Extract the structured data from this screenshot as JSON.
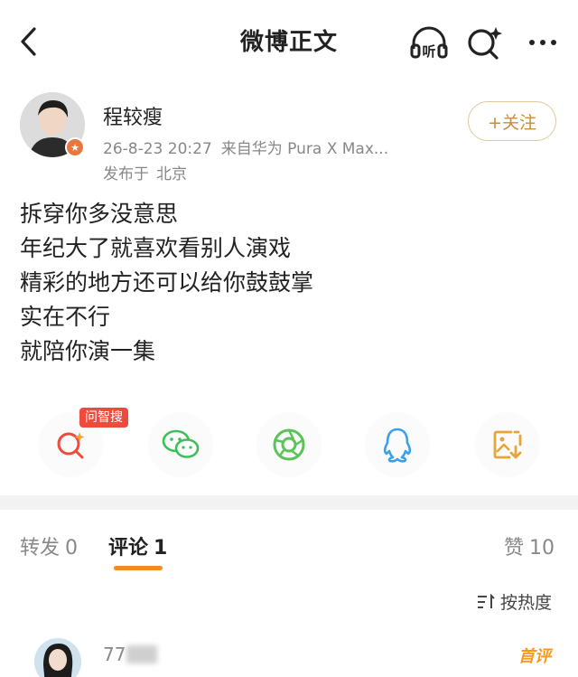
{
  "nav": {
    "title": "微博正文",
    "listen_label": "听"
  },
  "author": {
    "name": "程较瘦",
    "date": "26-8-23 20:27",
    "source": "来自华为 Pura X Max...",
    "location_prefix": "发布于",
    "location": "北京",
    "follow_label": "+关注"
  },
  "post": {
    "lines": [
      "拆穿你多没意思",
      "年纪大了就喜欢看别人演戏",
      "精彩的地方还可以给你鼓鼓掌",
      "实在不行",
      "就陪你演一集"
    ]
  },
  "share": {
    "smart_tag": "问智搜",
    "items": [
      {
        "icon": "smart-search-icon",
        "color": "#f04a3c"
      },
      {
        "icon": "wechat-icon",
        "color": "#3cbf5a"
      },
      {
        "icon": "moments-icon",
        "color": "#5ac35a"
      },
      {
        "icon": "qq-icon",
        "color": "#3aa0e8"
      },
      {
        "icon": "save-image-icon",
        "color": "#e8a53a"
      }
    ]
  },
  "tabs": {
    "repost_label": "转发",
    "repost_count": "0",
    "comment_label": "评论",
    "comment_count": "1",
    "like_label": "赞",
    "like_count": "10"
  },
  "sort": {
    "label": "按热度"
  },
  "comment": {
    "name_visible": "77",
    "tag": "首评"
  },
  "colors": {
    "accent": "#f48b1f",
    "follow": "#c98b3f",
    "badge": "#f04a3c"
  }
}
